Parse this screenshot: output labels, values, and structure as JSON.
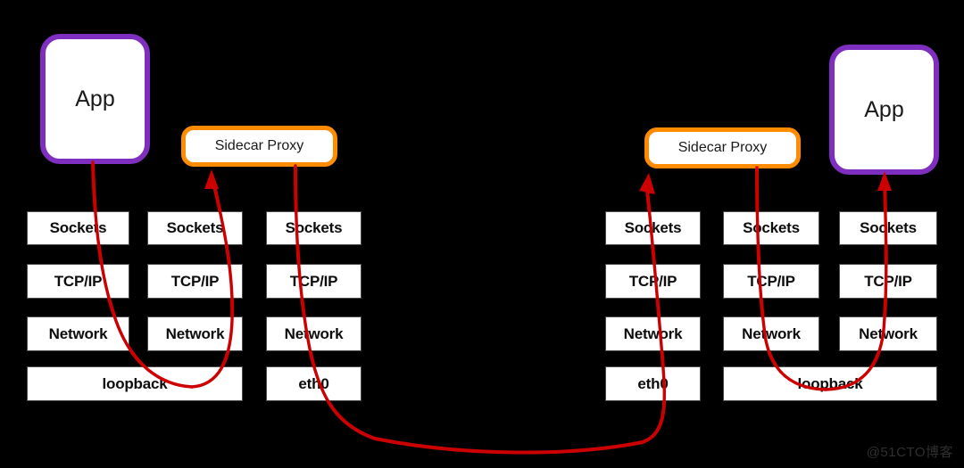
{
  "diagram": {
    "title": "Sidecar Proxy Network Stack Traffic Path",
    "background_color": "#000000",
    "wire_color": "#cc0000",
    "app_border_color": "#7f2fbf",
    "proxy_border_color": "#ff8c00",
    "layer_box_fill": "#ffffff"
  },
  "left_host": {
    "app": {
      "label": "App"
    },
    "proxy": {
      "label": "Sidecar Proxy"
    },
    "columns": [
      {
        "name": "app-stack",
        "layers": [
          {
            "label": "Sockets"
          },
          {
            "label": "TCP/IP"
          },
          {
            "label": "Network"
          }
        ]
      },
      {
        "name": "proxy-inbound-stack",
        "layers": [
          {
            "label": "Sockets"
          },
          {
            "label": "TCP/IP"
          },
          {
            "label": "Network"
          }
        ]
      },
      {
        "name": "proxy-outbound-stack",
        "layers": [
          {
            "label": "Sockets"
          },
          {
            "label": "TCP/IP"
          },
          {
            "label": "Network"
          }
        ]
      }
    ],
    "interfaces": [
      {
        "label": "loopback"
      },
      {
        "label": "eth0"
      }
    ]
  },
  "right_host": {
    "app": {
      "label": "App"
    },
    "proxy": {
      "label": "Sidecar Proxy"
    },
    "columns": [
      {
        "name": "proxy-inbound-stack",
        "layers": [
          {
            "label": "Sockets"
          },
          {
            "label": "TCP/IP"
          },
          {
            "label": "Network"
          }
        ]
      },
      {
        "name": "proxy-outbound-stack",
        "layers": [
          {
            "label": "Sockets"
          },
          {
            "label": "TCP/IP"
          },
          {
            "label": "Network"
          }
        ]
      },
      {
        "name": "app-stack",
        "layers": [
          {
            "label": "Sockets"
          },
          {
            "label": "TCP/IP"
          },
          {
            "label": "Network"
          }
        ]
      }
    ],
    "interfaces": [
      {
        "label": "eth0"
      },
      {
        "label": "loopback"
      }
    ]
  },
  "watermark": {
    "text": "@51CTO博客"
  }
}
